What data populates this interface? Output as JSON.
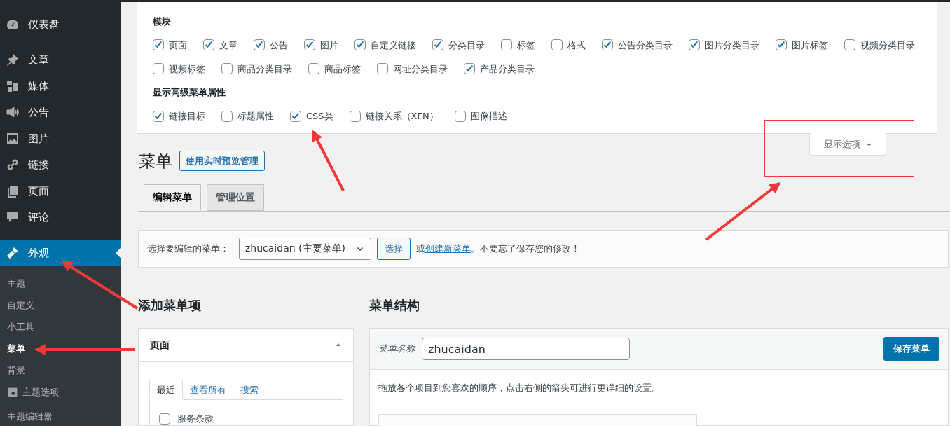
{
  "sidebar": {
    "items": [
      {
        "label": "仪表盘",
        "selected": false
      },
      {
        "label": "文章",
        "selected": false
      },
      {
        "label": "媒体",
        "selected": false
      },
      {
        "label": "公告",
        "selected": false
      },
      {
        "label": "图片",
        "selected": false
      },
      {
        "label": "链接",
        "selected": false
      },
      {
        "label": "页面",
        "selected": false
      },
      {
        "label": "评论",
        "selected": false
      },
      {
        "label": "外观",
        "selected": true
      }
    ],
    "submenu": [
      {
        "label": "主题",
        "selected": false
      },
      {
        "label": "自定义",
        "selected": false
      },
      {
        "label": "小工具",
        "selected": false
      },
      {
        "label": "菜单",
        "selected": true
      },
      {
        "label": "背景",
        "selected": false
      },
      {
        "label": "主题选项",
        "selected": false
      },
      {
        "label": "主题编辑器",
        "selected": false
      }
    ]
  },
  "screen_options": {
    "sections": [
      {
        "heading": "模块",
        "options": [
          {
            "label": "页面",
            "checked": true
          },
          {
            "label": "文章",
            "checked": true
          },
          {
            "label": "公告",
            "checked": true
          },
          {
            "label": "图片",
            "checked": true
          },
          {
            "label": "自定义链接",
            "checked": true
          },
          {
            "label": "分类目录",
            "checked": true
          },
          {
            "label": "标签",
            "checked": false
          },
          {
            "label": "格式",
            "checked": false
          },
          {
            "label": "公告分类目录",
            "checked": true
          },
          {
            "label": "图片分类目录",
            "checked": true
          },
          {
            "label": "图片标签",
            "checked": true
          },
          {
            "label": "视频分类目录",
            "checked": false
          },
          {
            "label": "视频标签",
            "checked": false
          },
          {
            "label": "商品分类目录",
            "checked": false
          },
          {
            "label": "商品标签",
            "checked": false
          },
          {
            "label": "网址分类目录",
            "checked": false
          },
          {
            "label": "产品分类目录",
            "checked": true
          }
        ]
      },
      {
        "heading": "显示高级菜单属性",
        "options": [
          {
            "label": "链接目标",
            "checked": true
          },
          {
            "label": "标题属性",
            "checked": false
          },
          {
            "label": "CSS类",
            "checked": true
          },
          {
            "label": "链接关系（XFN）",
            "checked": false
          },
          {
            "label": "图像描述",
            "checked": false
          }
        ]
      }
    ],
    "toggle": "显示选项"
  },
  "page_title": "菜单",
  "preview_button": "使用实时预览管理",
  "tabs": [
    {
      "label": "编辑菜单",
      "selected": true
    },
    {
      "label": "管理位置",
      "selected": false
    }
  ],
  "select_bar": {
    "label": "选择要编辑的菜单：",
    "value": "zhucaidan (主要菜单)",
    "button": "选择",
    "text_before": "或",
    "link": "创建新菜单",
    "text_after": "。不要忘了保存您的修改！"
  },
  "add_items": {
    "heading": "添加菜单项",
    "panel_title": "页面",
    "tabs": [
      {
        "label": "最近",
        "selected": true
      },
      {
        "label": "查看所有",
        "selected": false
      },
      {
        "label": "搜索",
        "selected": false
      }
    ],
    "items": [
      {
        "label": "服务条款",
        "checked": false
      }
    ]
  },
  "structure": {
    "heading": "菜单结构",
    "name_label": "菜单名称",
    "name_value": "zhucaidan",
    "save_button": "保存菜单",
    "instructions": "拖放各个项目到您喜欢的顺序，点击右侧的箭头可进行更详细的设置。"
  }
}
